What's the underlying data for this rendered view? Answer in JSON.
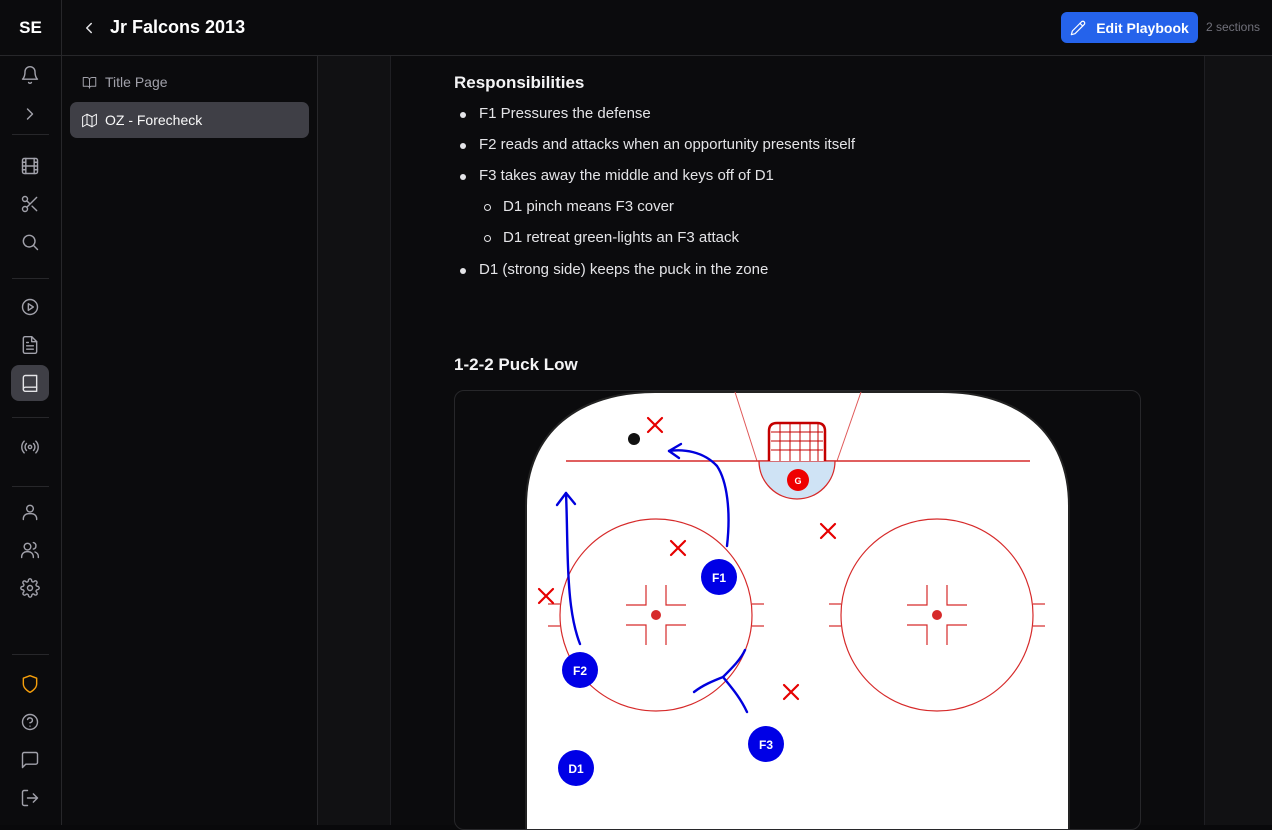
{
  "app": {
    "logo": "SE"
  },
  "header": {
    "title": "Jr Falcons 2013",
    "edit_label": "Edit Playbook",
    "sections_label": "2 sections"
  },
  "sidebar": {
    "items": [
      {
        "label": "Title Page",
        "icon": "book-open-icon"
      },
      {
        "label": "OZ - Forecheck",
        "icon": "map-icon",
        "active": true
      }
    ]
  },
  "nav_rail": {
    "icons": [
      "bell-icon",
      "chevron-right-icon",
      "film-icon",
      "scissors-icon",
      "search-icon",
      "play-circle-icon",
      "file-text-icon",
      "book-icon",
      "broadcast-icon",
      "user-icon",
      "users-icon",
      "settings-icon",
      "shield-icon",
      "help-circle-icon",
      "message-square-icon",
      "log-out-icon"
    ],
    "active": "book-icon",
    "shield_color": "#f59e0b"
  },
  "content": {
    "responsibilities_heading": "Responsibilities",
    "items": [
      "F1 Pressures the defense",
      "F2 reads and attacks when an opportunity presents itself",
      "F3 takes away the middle and keys off of D1"
    ],
    "sub_items": [
      "D1 pinch means F3 cover",
      "D1 retreat green-lights an F3 attack"
    ],
    "last_item": "D1 (strong side) keeps the puck in the zone",
    "diagram_heading": "1-2-2 Puck Low"
  },
  "diagram": {
    "goalie_label": "G",
    "players": [
      "F1",
      "F2",
      "F3",
      "D1"
    ],
    "player_color": "#0000e6",
    "opponent_color": "#e60000"
  }
}
